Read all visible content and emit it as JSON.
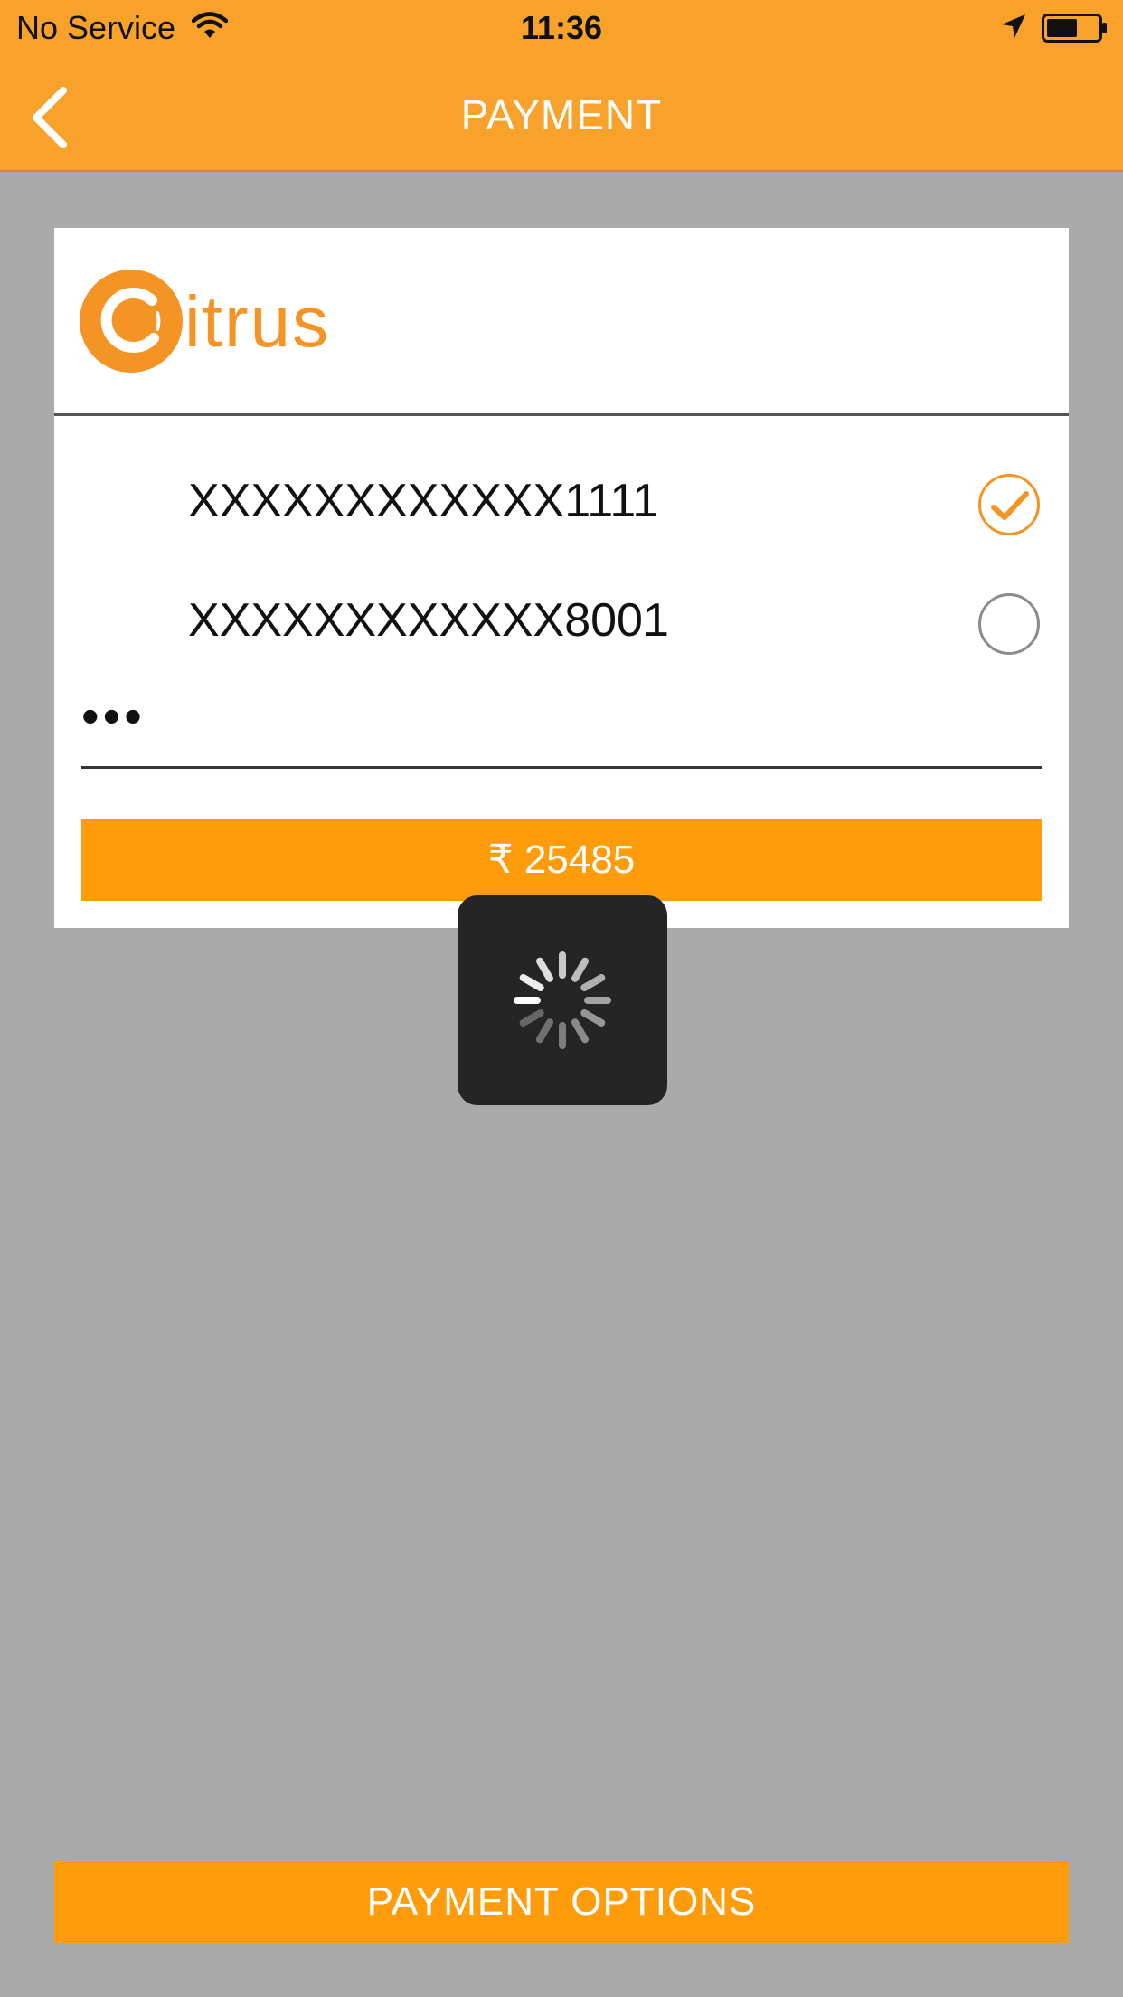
{
  "status_bar": {
    "carrier": "No Service",
    "time": "11:36"
  },
  "nav": {
    "title": "PAYMENT"
  },
  "brand": {
    "name": "itrus"
  },
  "saved_cards": [
    {
      "number": "XXXXXXXXXXXX1111",
      "selected": true
    },
    {
      "number": "XXXXXXXXXXXX8001",
      "selected": false
    }
  ],
  "cvv": {
    "masked_value": "•••"
  },
  "pay_button": {
    "label": "₹ 25485"
  },
  "footer": {
    "payment_options_label": "PAYMENT OPTIONS"
  },
  "colors": {
    "header_orange": "#f8a22c",
    "button_orange": "#ff9c0b",
    "brand_orange": "#f39424",
    "overlay_gray": "#aaaaaa",
    "hud_dark": "#252525"
  },
  "icons": {
    "back": "chevron-left-icon",
    "wifi": "wifi-icon",
    "location": "location-arrow-icon",
    "battery": "battery-icon",
    "selected_radio": "checkmark-icon",
    "spinner": "loading-spinner-icon"
  }
}
